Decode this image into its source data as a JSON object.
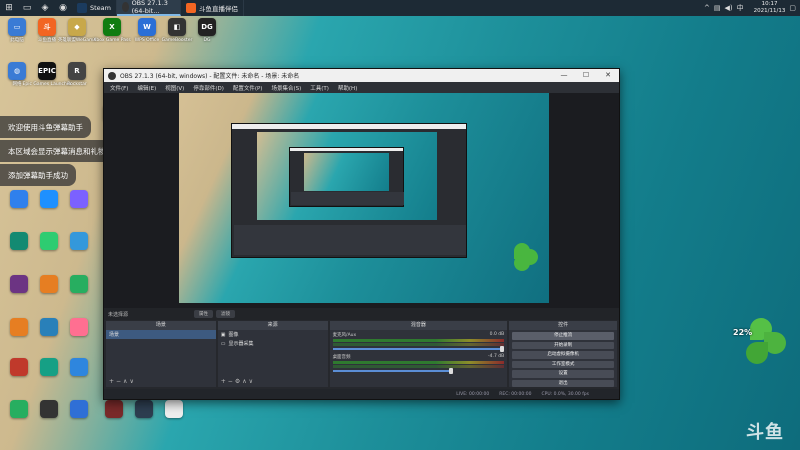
{
  "taskbar": {
    "tasks": [
      {
        "label": "Steam",
        "color": "#1b3b5e"
      },
      {
        "label": "OBS 27.1.3 (64-bit...",
        "color": "#333333"
      },
      {
        "label": "斗鱼直播伴侣",
        "color": "#f26522"
      }
    ],
    "clock_time": "10:17",
    "clock_date": "2021/11/13"
  },
  "desktop_icons": [
    {
      "label": "此电脑",
      "color": "#3a7bd5",
      "glyph": "▭"
    },
    {
      "label": "斗鱼直播",
      "color": "#f26522",
      "glyph": "斗"
    },
    {
      "label": "英雄联盟WeGame",
      "color": "#c8a84a",
      "glyph": "◆"
    },
    {
      "label": "Xbox Game Pass",
      "color": "#107c10",
      "glyph": "X"
    },
    {
      "label": "WPS Office",
      "color": "#2b6fd6",
      "glyph": "W"
    },
    {
      "label": "GameBooster",
      "color": "#333",
      "glyph": "◧"
    },
    {
      "label": "DG",
      "color": "#222",
      "glyph": "DG"
    },
    {
      "label": "网络",
      "color": "#3a7bd5",
      "glyph": "◍"
    },
    {
      "label": "Epic Games Launcher",
      "color": "#111",
      "glyph": "EPIC"
    },
    {
      "label": "Rockstar",
      "color": "#444",
      "glyph": "R"
    },
    {
      "label": "Steam",
      "color": "#1b3b5e",
      "glyph": "S"
    }
  ],
  "toasts": [
    "欢迎使用斗鱼弹幕助手",
    "本区域会显示弹幕消息和礼物消息",
    "添加弹幕助手成功"
  ],
  "obs": {
    "title": "OBS 27.1.3 (64-bit, windows) - 配置文件: 未命名 - 场景: 未命名",
    "menu": [
      "文件(F)",
      "编辑(E)",
      "视图(V)",
      "停靠部件(D)",
      "配置文件(P)",
      "场景集合(S)",
      "工具(T)",
      "帮助(H)"
    ],
    "scene_label": "未选择源",
    "prop_button": "属性",
    "filter_button": "滤镜",
    "docks": {
      "scenes": {
        "title": "场景",
        "items": [
          "场景"
        ]
      },
      "sources": {
        "title": "来源",
        "items": [
          "图像",
          "显示器采集"
        ]
      },
      "mixer": {
        "title": "混音器",
        "channels": [
          {
            "name": "麦克风/Aux",
            "db": "0.0 dB"
          },
          {
            "name": "桌面音频",
            "db": "-4.7 dB"
          }
        ]
      },
      "controls": {
        "title": "控件",
        "buttons": [
          "停止推流",
          "开始录制",
          "启动虚拟摄像机",
          "工作室模式",
          "设置",
          "退出"
        ]
      }
    },
    "status": {
      "live": "LIVE: 00:00:00",
      "rec": "REC: 00:00:00",
      "cpu": "CPU: 0.0%, 30.00 fps"
    }
  },
  "overlay": {
    "percent": "22%",
    "watermark": "斗鱼"
  }
}
